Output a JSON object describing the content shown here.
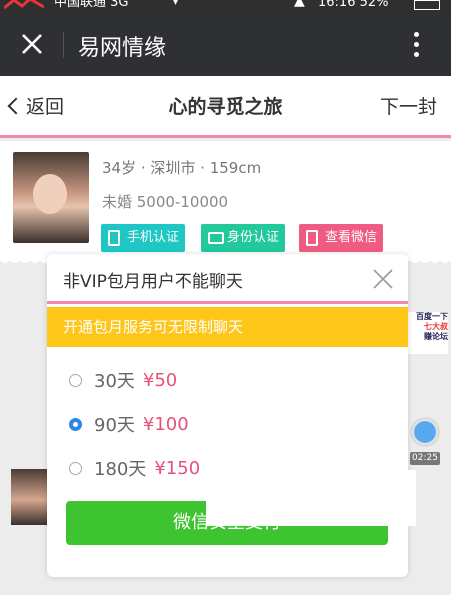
{
  "status_bar": {
    "carrier": "中国联通 3G",
    "time": "16:16 52%"
  },
  "title_bar": {
    "title": "易网情缘"
  },
  "nav": {
    "back_label": "返回",
    "title": "心的寻觅之旅",
    "next_label": "下一封"
  },
  "profile": {
    "line1": "34岁 · 深圳市 · 159cm",
    "line2": "未婚 5000-10000",
    "tags": [
      "手机认证",
      "身份认证",
      "查看微信"
    ]
  },
  "side_ad": {
    "line1": "百度一下",
    "line2": "七大叔",
    "line3": "赚论坛"
  },
  "timer": "02:25",
  "modal": {
    "title": "非VIP包月用户不能聊天",
    "notice": "开通包月服务可无限制聊天",
    "options": [
      {
        "days": "30天",
        "price": "¥50",
        "selected": false
      },
      {
        "days": "90天",
        "price": "¥100",
        "selected": true
      },
      {
        "days": "180天",
        "price": "¥150",
        "selected": false
      }
    ],
    "pay_label": "微信安全支付"
  },
  "colors": {
    "accent_pink": "#f08aa6",
    "notice_yellow": "#ffc61a",
    "pay_green": "#3ec431",
    "price_red": "#e8517a"
  }
}
